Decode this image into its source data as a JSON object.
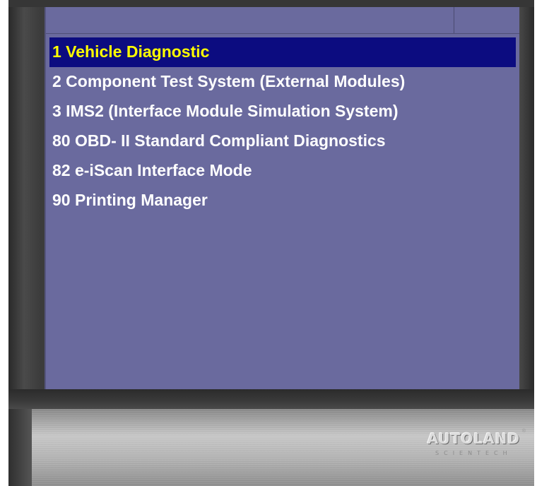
{
  "menu": {
    "items": [
      {
        "label": "1 Vehicle Diagnostic",
        "selected": true
      },
      {
        "label": "2 Component Test System (External Modules)",
        "selected": false
      },
      {
        "label": "3 IMS2 (Interface Module Simulation System)",
        "selected": false
      },
      {
        "label": "80 OBD- II Standard Compliant Diagnostics",
        "selected": false
      },
      {
        "label": "82 e-iScan Interface Mode",
        "selected": false
      },
      {
        "label": "90 Printing Manager",
        "selected": false
      }
    ]
  },
  "branding": {
    "logo_text": "AUTOLAND",
    "logo_subtext": "SCIENTECH",
    "registered_mark": "®"
  },
  "colors": {
    "screen_background": "#6a6a9e",
    "selected_background": "#0c0c80",
    "selected_text": "#ffff00",
    "item_text": "#ffffff"
  }
}
